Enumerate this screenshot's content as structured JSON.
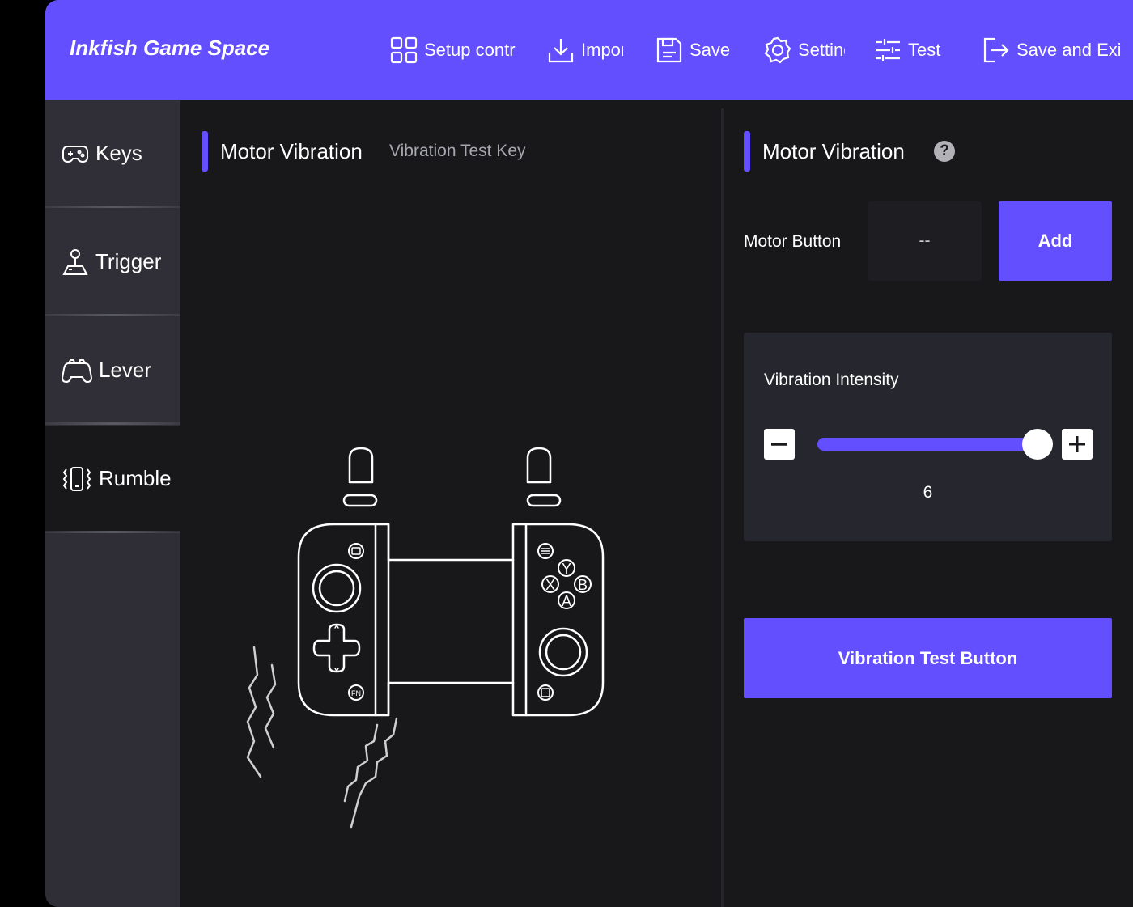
{
  "app": {
    "title": "Inkfish Game Space"
  },
  "toolbar": {
    "setup": "Setup controller",
    "import": "Import",
    "save": "Save",
    "settings": "Settings",
    "test": "Test",
    "save_exit": "Save and Exit"
  },
  "sidebar": {
    "items": [
      {
        "label": "Keys",
        "icon": "gamepad-icon"
      },
      {
        "label": "Trigger",
        "icon": "joystick-icon"
      },
      {
        "label": "Lever",
        "icon": "controller-icon"
      },
      {
        "label": "Rumble",
        "icon": "vibrate-icon"
      }
    ],
    "active_index": 3
  },
  "main": {
    "title": "Motor Vibration",
    "subtitle": "Vibration Test Key"
  },
  "panel": {
    "title": "Motor Vibration",
    "help_glyph": "?",
    "motor_button_label": "Motor Button",
    "motor_button_value": "--",
    "add_label": "Add",
    "intensity_label": "Vibration Intensity",
    "intensity_value": "6",
    "test_button_label": "Vibration Test Button"
  },
  "controller": {
    "face_buttons": [
      "Y",
      "X",
      "B",
      "A"
    ],
    "fn_label": "FN"
  },
  "colors": {
    "accent": "#634ffd",
    "background": "#18181b",
    "sidebar": "#302f37",
    "card": "#26262f"
  }
}
